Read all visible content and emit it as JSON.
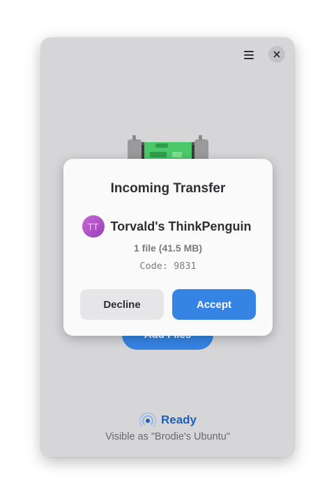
{
  "window": {
    "icons": {
      "menu": "hamburger-menu-icon",
      "close": "close-icon"
    }
  },
  "main": {
    "add_files_label": "Add Files",
    "status": "Ready",
    "visible_as": "Visible as \"Brodie's Ubuntu\""
  },
  "dialog": {
    "title": "Incoming Transfer",
    "avatar_initials": "TT",
    "sender_name": "Torvald's ThinkPenguin",
    "file_info": "1 file (41.5 MB)",
    "code": "Code: 9831",
    "decline_label": "Decline",
    "accept_label": "Accept"
  },
  "colors": {
    "accent": "#3584e4",
    "status": "#1c5fb8",
    "avatar": "#b055cc"
  }
}
